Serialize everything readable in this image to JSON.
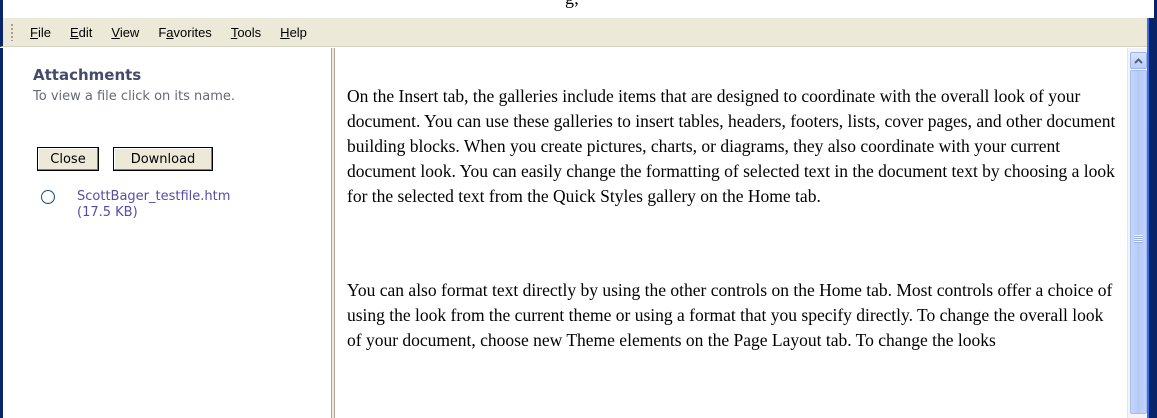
{
  "title_fragment": "g;",
  "menubar": {
    "items": [
      {
        "label": "File"
      },
      {
        "label": "Edit"
      },
      {
        "label": "View"
      },
      {
        "label": "Favorites"
      },
      {
        "label": "Tools"
      },
      {
        "label": "Help"
      }
    ]
  },
  "attachments": {
    "heading": "Attachments",
    "hint": "To view a file click on its name.",
    "close_label": "Close",
    "download_label": "Download",
    "file": {
      "name": "ScottBager_testfile.htm",
      "size": "(17.5 KB)",
      "selected": false
    }
  },
  "content": {
    "paragraphs": [
      "On the Insert tab, the galleries include items that are designed to coordinate with the overall look of your document. You can use these galleries to insert tables, headers, footers, lists, cover pages, and other document building blocks. When you create pictures, charts, or diagrams, they also coordinate with your current document look. You can easily change the formatting of selected text in the document text by choosing a look for the selected text from the Quick Styles gallery on the Home tab.",
      "You can also format text directly by using the other controls on the Home tab. Most controls offer a choice of using the look from the current theme or using a format that you specify directly. To change the overall look of your document, choose new Theme elements on the Page Layout tab. To change the looks"
    ]
  },
  "scrollbar": {
    "up_icon": "triangle-up"
  },
  "colors": {
    "menubar_bg": "#ece9d8",
    "heading": "#434a6a",
    "link": "#5b4aa6",
    "window_border": "#0a246a"
  }
}
